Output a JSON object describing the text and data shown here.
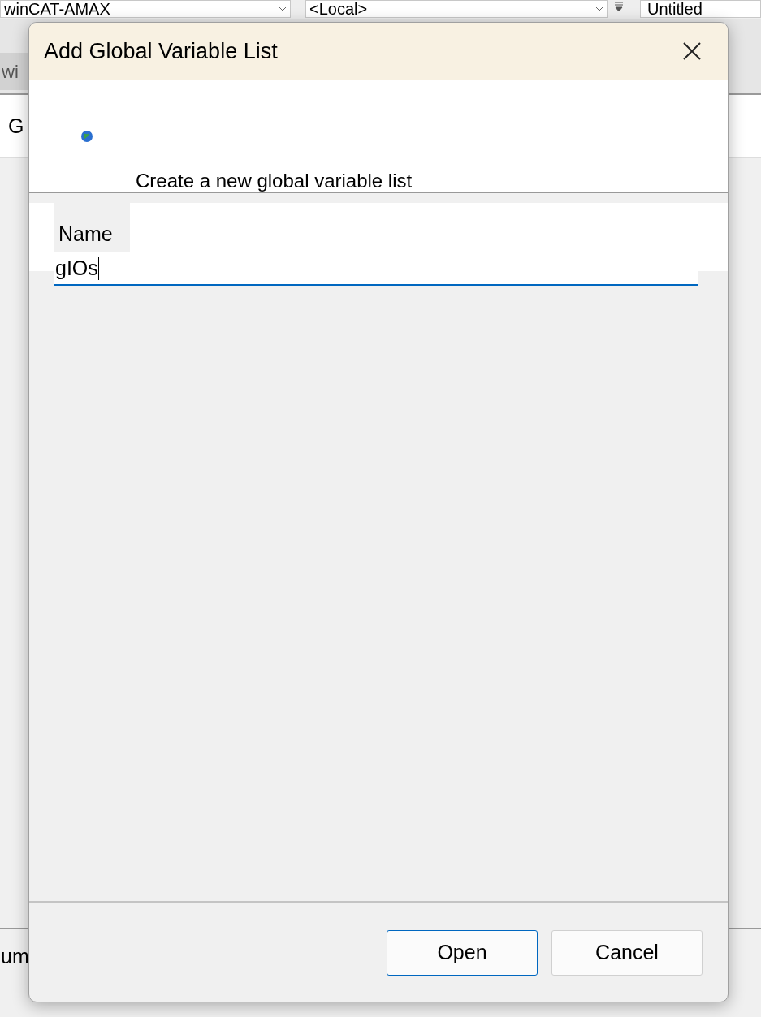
{
  "background": {
    "toolbar": {
      "dropdowns": [
        {
          "value": "winCAT-AMAX"
        },
        {
          "value": "<Local>"
        }
      ],
      "document": "Untitled"
    },
    "tab": "wi",
    "row_label": "G",
    "status_label": "um"
  },
  "dialog": {
    "title": "Add Global Variable List",
    "header_text": "Create a new global variable list",
    "field": {
      "label": "Name",
      "value": "gIOs",
      "focused": true
    },
    "buttons": [
      {
        "label": "Open",
        "default": true
      },
      {
        "label": "Cancel",
        "default": false
      }
    ]
  }
}
